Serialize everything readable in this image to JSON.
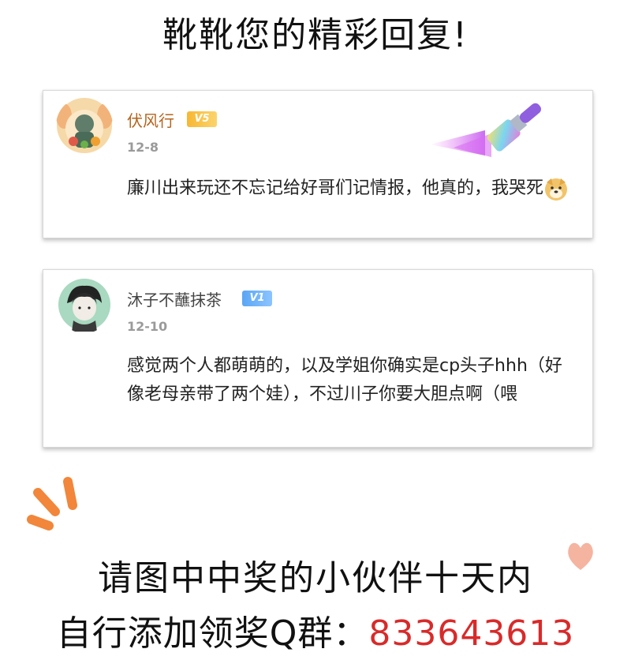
{
  "page": {
    "title": "靴靴您的精彩回复!"
  },
  "comments": [
    {
      "username": "伏风行",
      "badge": "V5",
      "date": "12-8",
      "text": "廉川出来玩还不忘记给好哥们记情报，他真的，我哭死",
      "emoji": "dog-emoji",
      "username_color": "#b5651d",
      "badge_color": "#f7b733"
    },
    {
      "username": "沐子不蘸抹茶",
      "badge": "V1",
      "date": "12-10",
      "text": "感觉两个人都萌萌的，以及学姐你确实是cp头子hhh（好像老母亲带了两个娃），不过川子你要大胆点啊（喂",
      "username_color": "#444444",
      "badge_color": "#5aa6f5"
    }
  ],
  "footer": {
    "line1": "请图中中奖的小伙伴十天内",
    "line2_prefix": "自行添加领奖Q群：",
    "group_number": "833643613",
    "number_color": "#d92a2a"
  }
}
